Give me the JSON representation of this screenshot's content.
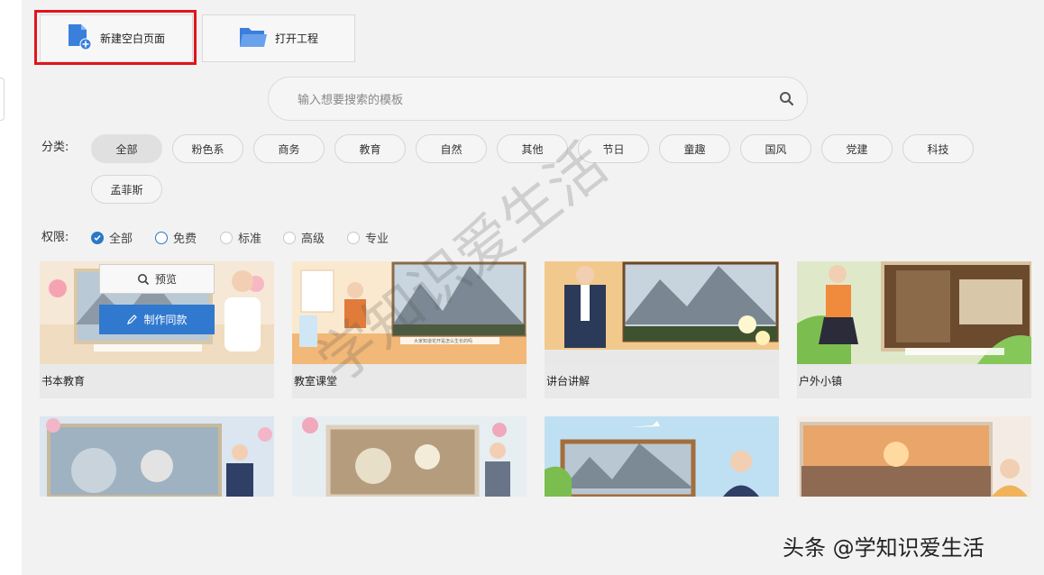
{
  "toolbar": {
    "new_blank_label": "新建空白页面",
    "open_project_label": "打开工程"
  },
  "search": {
    "placeholder": "输入想要搜索的模板"
  },
  "category": {
    "label": "分类:",
    "items": [
      "全部",
      "粉色系",
      "商务",
      "教育",
      "自然",
      "其他",
      "节日",
      "童趣",
      "国风",
      "党建",
      "科技",
      "孟菲斯"
    ],
    "active": "全部"
  },
  "permission": {
    "label": "权限:",
    "items": [
      "全部",
      "免费",
      "标准",
      "高级",
      "专业"
    ],
    "selected": "全部"
  },
  "templates": [
    {
      "title": "书本教育"
    },
    {
      "title": "教室课堂"
    },
    {
      "title": "讲台讲解"
    },
    {
      "title": "户外小镇"
    },
    {
      "title": ""
    },
    {
      "title": ""
    },
    {
      "title": ""
    },
    {
      "title": ""
    }
  ],
  "card_overlay": {
    "preview_label": "预览",
    "make_label": "制作同款"
  },
  "thumb_caption": "大家知道花开是怎么生长的吗",
  "watermark": {
    "text": "头条 @学知识爱生活",
    "diagonal": "学知识爱生活"
  },
  "colors": {
    "accent": "#2a78c8",
    "highlight": "#e1151c",
    "make_button": "#3079cf"
  }
}
